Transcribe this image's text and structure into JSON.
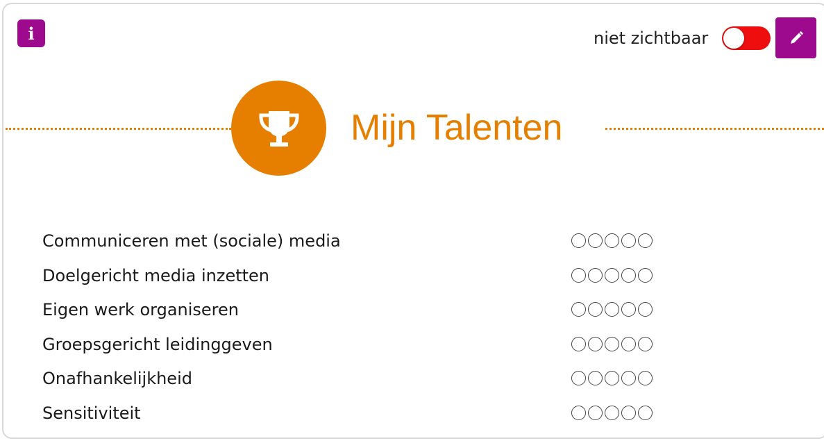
{
  "header": {
    "info_icon_glyph": "i",
    "visibility_label": "niet zichtbaar",
    "visibility_on": false,
    "toggle_color": "#ee0e0e"
  },
  "section": {
    "title": "Mijn Talenten",
    "icon": "trophy-icon",
    "accent_color": "#e67e00"
  },
  "brand_color": "#9e0a8e",
  "talents": [
    {
      "name": "Communiceren met (sociale) media",
      "rating": 0,
      "max": 5
    },
    {
      "name": "Doelgericht media inzetten",
      "rating": 0,
      "max": 5
    },
    {
      "name": "Eigen werk organiseren",
      "rating": 0,
      "max": 5
    },
    {
      "name": "Groepsgericht leidinggeven",
      "rating": 0,
      "max": 5
    },
    {
      "name": "Onafhankelijkheid",
      "rating": 0,
      "max": 5
    },
    {
      "name": "Sensitiviteit",
      "rating": 0,
      "max": 5
    }
  ]
}
